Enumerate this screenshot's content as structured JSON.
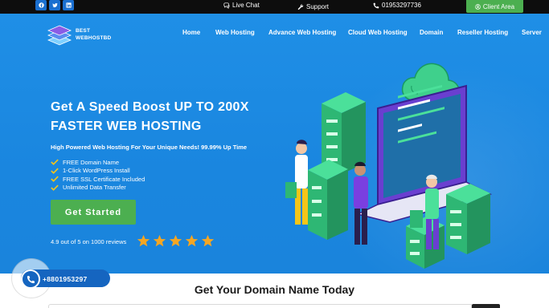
{
  "topbar": {
    "social_icons": [
      "facebook-icon",
      "twitter-icon",
      "linkedin-icon"
    ],
    "live_chat": "Live Chat",
    "support": "Support",
    "phone": "01953297736",
    "client_area": "Client Area"
  },
  "brand": {
    "line1": "BEST",
    "line2": "WEBHOSTBD"
  },
  "nav": {
    "items": [
      "Home",
      "Web Hosting",
      "Advance Web Hosting",
      "Cloud Web Hosting",
      "Domain",
      "Reseller Hosting",
      "Server"
    ]
  },
  "hero": {
    "headline_line1": "Get A Speed Boost UP TO 200X",
    "headline_line2": "FASTER WEB HOSTING",
    "subline": "High Powered Web Hosting For Your Unique Needs! 99.99% Up Time",
    "features": [
      "FREE Domain Name",
      "1-Click WordPress Install",
      "FREE SSL Certificate Included",
      "Unlimited Data Transfer"
    ],
    "cta": "Get Started",
    "rating_text": "4.9 out of 5 on 1000 reviews",
    "stars": 5
  },
  "phone_widget": {
    "number": "+8801953297"
  },
  "domain_section": {
    "title": "Get Your Domain Name Today"
  },
  "colors": {
    "hero_bg": "#1a86df",
    "accent_green": "#4caf50",
    "star": "#f5a623",
    "topbar_bg": "#0d0d0d",
    "phone_blue": "#1565c0"
  }
}
